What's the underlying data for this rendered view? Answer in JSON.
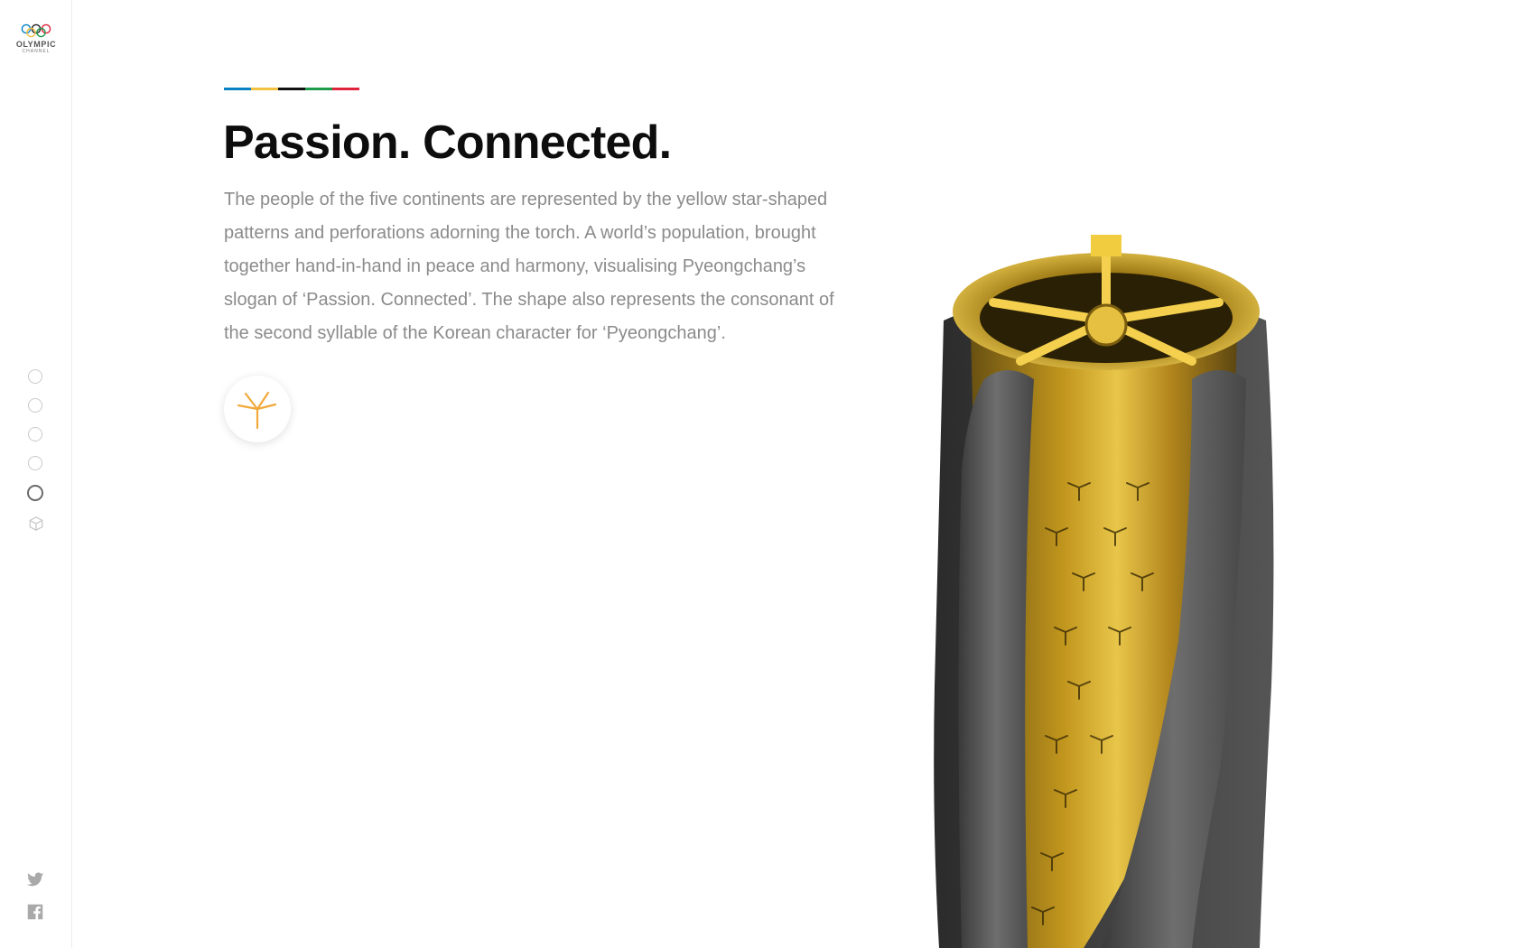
{
  "sidebar": {
    "logo": {
      "main": "OLYMPIC",
      "sub": "CHANNEL",
      "icon": "olympic-rings-icon"
    },
    "nav_dots": [
      {
        "active": false
      },
      {
        "active": false
      },
      {
        "active": false
      },
      {
        "active": false
      },
      {
        "active": true
      }
    ],
    "extra_nav_icon": "cube-icon",
    "social": [
      {
        "icon": "twitter-icon"
      },
      {
        "icon": "facebook-icon"
      }
    ]
  },
  "main": {
    "color_bar": [
      "#0a81c5",
      "#f3c141",
      "#111111",
      "#1f9a4b",
      "#e0233d"
    ],
    "title": "Passion. Connected.",
    "description": "The people of the five continents are represented by the yellow star-shaped patterns and perforations adorning the torch. A world’s population, brought together hand-in-hand in peace and harmony, visualising Pyeongchang’s slogan of ‘Passion. Connected’. The shape also represents the consonant of the second syllable of the Korean character for ‘Pyeongchang’.",
    "feature_button_icon": "star-icon",
    "accent_color": "#f2a93b"
  }
}
